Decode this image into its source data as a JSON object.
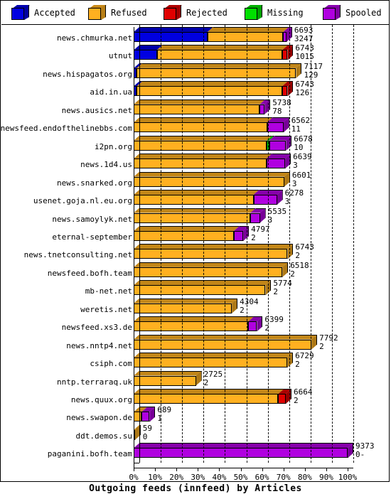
{
  "chart_data": {
    "type": "bar",
    "title": "Outgoing feeds (innfeed) by Articles",
    "xlabel": "Outgoing feeds (innfeed) by Articles",
    "ylabel": "",
    "orientation": "horizontal",
    "stacked": true,
    "grid": true,
    "xlim": [
      0,
      100
    ],
    "xunit": "%",
    "xticks": [
      "0%",
      "10%",
      "20%",
      "30%",
      "40%",
      "50%",
      "60%",
      "70%",
      "80%",
      "90%",
      "100%"
    ],
    "legend_position": "top",
    "series": [
      {
        "name": "Accepted",
        "color": "#0000e0"
      },
      {
        "name": "Refused",
        "color": "#ffb020"
      },
      {
        "name": "Rejected",
        "color": "#e00000"
      },
      {
        "name": "Missing",
        "color": "#00e000"
      },
      {
        "name": "Spooled",
        "color": "#b000e0"
      }
    ],
    "categories": [
      "news.chmurka.net",
      "utnut",
      "news.hispagatos.org",
      "aid.in.ua",
      "news.ausics.net",
      "newsfeed.endofthelinebbs.com",
      "i2pn.org",
      "news.1d4.us",
      "news.snarked.org",
      "usenet.goja.nl.eu.org",
      "news.samoylyk.net",
      "eternal-september",
      "news.tnetconsulting.net",
      "newsfeed.bofh.team",
      "mb-net.net",
      "weretis.net",
      "newsfeed.xs3.de",
      "news.nntp4.net",
      "csiph.com",
      "nntp.terraraq.uk",
      "news.quux.org",
      "news.swapon.de",
      "ddt.demos.su",
      "paganini.bofh.team"
    ],
    "rows": [
      {
        "label": "news.chmurka.net",
        "total_pct": 71.4,
        "value_top": "6693",
        "value_bottom": "3247",
        "segments": [
          {
            "series": "Accepted",
            "pct": 34.5
          },
          {
            "series": "Refused",
            "pct": 35.4
          },
          {
            "series": "Spooled",
            "pct": 1.5
          }
        ]
      },
      {
        "label": "utnut",
        "total_pct": 71.9,
        "value_top": "6743",
        "value_bottom": "1015",
        "segments": [
          {
            "series": "Accepted",
            "pct": 10.8
          },
          {
            "series": "Refused",
            "pct": 58.6
          },
          {
            "series": "Rejected",
            "pct": 2.5
          }
        ]
      },
      {
        "label": "news.hispagatos.org",
        "total_pct": 75.9,
        "value_top": "7117",
        "value_bottom": "129",
        "segments": [
          {
            "series": "Accepted",
            "pct": 1.4
          },
          {
            "series": "Refused",
            "pct": 74.5
          }
        ]
      },
      {
        "label": "aid.in.ua",
        "total_pct": 71.9,
        "value_top": "6743",
        "value_bottom": "126",
        "segments": [
          {
            "series": "Accepted",
            "pct": 1.4
          },
          {
            "series": "Refused",
            "pct": 68.0
          },
          {
            "series": "Rejected",
            "pct": 2.5
          }
        ]
      },
      {
        "label": "news.ausics.net",
        "total_pct": 61.2,
        "value_top": "5738",
        "value_bottom": "78",
        "segments": [
          {
            "series": "Refused",
            "pct": 58.9
          },
          {
            "series": "Spooled",
            "pct": 2.3
          }
        ]
      },
      {
        "label": "newsfeed.endofthelinebbs.com",
        "total_pct": 70.0,
        "value_top": "6562",
        "value_bottom": "11",
        "segments": [
          {
            "series": "Refused",
            "pct": 62.3
          },
          {
            "series": "Spooled",
            "pct": 7.7
          }
        ]
      },
      {
        "label": "i2pn.org",
        "total_pct": 71.2,
        "value_top": "6678",
        "value_bottom": "10",
        "segments": [
          {
            "series": "Refused",
            "pct": 62.1
          },
          {
            "series": "Missing",
            "pct": 1.2
          },
          {
            "series": "Spooled",
            "pct": 7.9
          }
        ]
      },
      {
        "label": "news.1d4.us",
        "total_pct": 70.8,
        "value_top": "6639",
        "value_bottom": "3",
        "segments": [
          {
            "series": "Refused",
            "pct": 62.0
          },
          {
            "series": "Spooled",
            "pct": 8.8
          }
        ]
      },
      {
        "label": "news.snarked.org",
        "total_pct": 70.4,
        "value_top": "6601",
        "value_bottom": "3",
        "segments": [
          {
            "series": "Refused",
            "pct": 70.4
          }
        ]
      },
      {
        "label": "usenet.goja.nl.eu.org",
        "total_pct": 67.0,
        "value_top": "6278",
        "value_bottom": "3",
        "segments": [
          {
            "series": "Refused",
            "pct": 56.0
          },
          {
            "series": "Spooled",
            "pct": 11.0
          }
        ]
      },
      {
        "label": "news.samoylyk.net",
        "total_pct": 59.0,
        "value_top": "5535",
        "value_bottom": "3",
        "segments": [
          {
            "series": "Refused",
            "pct": 54.5
          },
          {
            "series": "Spooled",
            "pct": 4.5
          }
        ]
      },
      {
        "label": "eternal-september",
        "total_pct": 51.2,
        "value_top": "4797",
        "value_bottom": "2",
        "segments": [
          {
            "series": "Refused",
            "pct": 46.8
          },
          {
            "series": "Spooled",
            "pct": 4.4
          }
        ]
      },
      {
        "label": "news.tnetconsulting.net",
        "total_pct": 71.9,
        "value_top": "6743",
        "value_bottom": "2",
        "segments": [
          {
            "series": "Refused",
            "pct": 71.9
          }
        ]
      },
      {
        "label": "newsfeed.bofh.team",
        "total_pct": 69.5,
        "value_top": "6518",
        "value_bottom": "2",
        "segments": [
          {
            "series": "Refused",
            "pct": 69.5
          }
        ]
      },
      {
        "label": "mb-net.net",
        "total_pct": 61.6,
        "value_top": "5774",
        "value_bottom": "2",
        "segments": [
          {
            "series": "Refused",
            "pct": 61.6
          }
        ]
      },
      {
        "label": "weretis.net",
        "total_pct": 45.9,
        "value_top": "4304",
        "value_bottom": "2",
        "segments": [
          {
            "series": "Refused",
            "pct": 45.9
          }
        ]
      },
      {
        "label": "newsfeed.xs3.de",
        "total_pct": 57.6,
        "value_top": "6399",
        "value_bottom": "2",
        "segments": [
          {
            "series": "Refused",
            "pct": 53.6
          },
          {
            "series": "Spooled",
            "pct": 4.0
          }
        ]
      },
      {
        "label": "news.nntp4.net",
        "total_pct": 83.1,
        "value_top": "7792",
        "value_bottom": "2",
        "segments": [
          {
            "series": "Refused",
            "pct": 83.1
          }
        ]
      },
      {
        "label": "csiph.com",
        "total_pct": 71.8,
        "value_top": "6729",
        "value_bottom": "2",
        "segments": [
          {
            "series": "Refused",
            "pct": 71.8
          }
        ]
      },
      {
        "label": "nntp.terraraq.uk",
        "total_pct": 29.1,
        "value_top": "2725",
        "value_bottom": "2",
        "segments": [
          {
            "series": "Refused",
            "pct": 29.1
          }
        ]
      },
      {
        "label": "news.quux.org",
        "total_pct": 71.1,
        "value_top": "6664",
        "value_bottom": "2",
        "segments": [
          {
            "series": "Refused",
            "pct": 67.6
          },
          {
            "series": "Rejected",
            "pct": 3.5
          }
        ]
      },
      {
        "label": "news.swapon.de",
        "total_pct": 7.4,
        "value_top": "689",
        "value_bottom": "1",
        "segments": [
          {
            "series": "Refused",
            "pct": 3.7
          },
          {
            "series": "Spooled",
            "pct": 3.7
          }
        ]
      },
      {
        "label": "ddt.demos.su",
        "total_pct": 0.6,
        "value_top": "59",
        "value_bottom": "0",
        "segments": [
          {
            "series": "Refused",
            "pct": 0.6
          }
        ]
      },
      {
        "label": "paganini.bofh.team",
        "total_pct": 100.0,
        "value_top": "9373",
        "value_bottom": "0-",
        "segments": [
          {
            "series": "Spooled",
            "pct": 100.0
          }
        ]
      }
    ]
  }
}
